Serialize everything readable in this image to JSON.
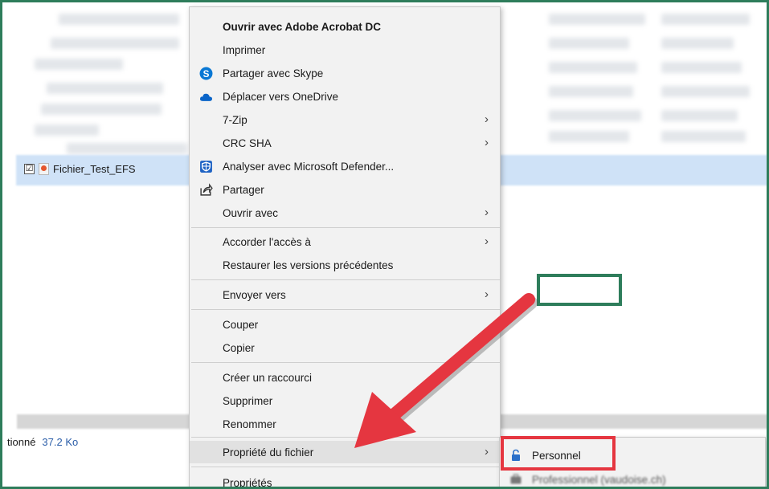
{
  "explorer": {
    "file_name": "Fichier_Test_EFS",
    "checkbox_mark": "☑",
    "status_text": "tionné",
    "status_size": "37.2 Ko"
  },
  "context_menu": {
    "items": [
      {
        "label": "Ouvrir avec Adobe Acrobat DC",
        "icon": "",
        "submenu": false
      },
      {
        "label": "Imprimer",
        "icon": "",
        "submenu": false
      },
      {
        "label": "Partager avec Skype",
        "icon": "skype-icon",
        "submenu": false
      },
      {
        "label": "Déplacer vers OneDrive",
        "icon": "onedrive-cloud-icon",
        "submenu": false
      },
      {
        "label": "7-Zip",
        "icon": "",
        "submenu": true
      },
      {
        "label": "CRC SHA",
        "icon": "",
        "submenu": true
      },
      {
        "label": "Analyser avec Microsoft Defender...",
        "icon": "defender-shield-icon",
        "submenu": false
      },
      {
        "label": "Partager",
        "icon": "share-icon",
        "submenu": false
      },
      {
        "label": "Ouvrir avec",
        "icon": "",
        "submenu": true
      },
      {
        "label": "Accorder l'accès à",
        "icon": "",
        "submenu": true
      },
      {
        "label": "Restaurer les versions précédentes",
        "icon": "",
        "submenu": false
      },
      {
        "label": "Envoyer vers",
        "icon": "",
        "submenu": true
      },
      {
        "label": "Couper",
        "icon": "",
        "submenu": false
      },
      {
        "label": "Copier",
        "icon": "",
        "submenu": false
      },
      {
        "label": "Créer un raccourci",
        "icon": "",
        "submenu": false
      },
      {
        "label": "Supprimer",
        "icon": "",
        "submenu": false
      },
      {
        "label": "Renommer",
        "icon": "",
        "submenu": false
      },
      {
        "label": "Propriété du fichier",
        "icon": "",
        "submenu": true
      },
      {
        "label": "Propriétés",
        "icon": "",
        "submenu": false
      }
    ],
    "submenu_arrow": "›"
  },
  "submenu": {
    "items": [
      {
        "label": "Personnel",
        "icon": "lock-icon"
      },
      {
        "label": "Professionnel (vaudoise.ch)",
        "icon": "briefcase-icon"
      }
    ]
  },
  "colors": {
    "frame": "#2e7d5b",
    "highlight_red": "#e53640",
    "arrow": "#e53640",
    "onedrive": "#0a64c8",
    "skype": "#0a78d4",
    "lock": "#2a6fc9"
  }
}
